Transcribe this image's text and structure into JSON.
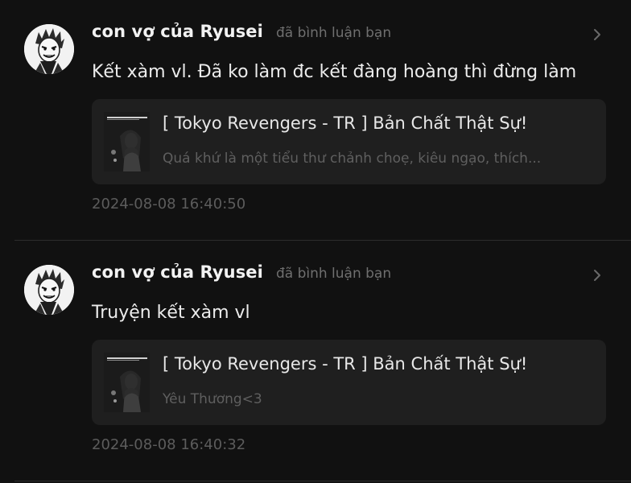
{
  "notifications": [
    {
      "username": "con vợ của Ryusei",
      "action": "đã bình luận bạn",
      "comment": "Kết xàm vl. Đã ko làm đc kết đàng hoàng thì đừng làm",
      "story_title": "[ Tokyo Revengers - TR ] Bản Chất Thật Sự!",
      "story_description": "Quá khứ là một tiểu thư chảnh choẹ, kiêu ngạo, thích...",
      "timestamp": "2024-08-08 16:40:50"
    },
    {
      "username": "con vợ của Ryusei",
      "action": "đã bình luận bạn",
      "comment": "Truyện kết xàm vl",
      "story_title": "[ Tokyo Revengers - TR ] Bản Chất Thật Sự!",
      "story_description": "Yêu Thương<3",
      "timestamp": "2024-08-08 16:40:32"
    }
  ],
  "icons": {
    "chevron": "chevron-right-icon",
    "avatar": "manga-character-avatar",
    "thumbnail": "story-cover-thumbnail"
  },
  "colors": {
    "background": "#111111",
    "card": "#1f1f1f",
    "primary_text": "#ececec",
    "secondary_text": "#6f6f6f",
    "divider": "#2c2c2c"
  }
}
